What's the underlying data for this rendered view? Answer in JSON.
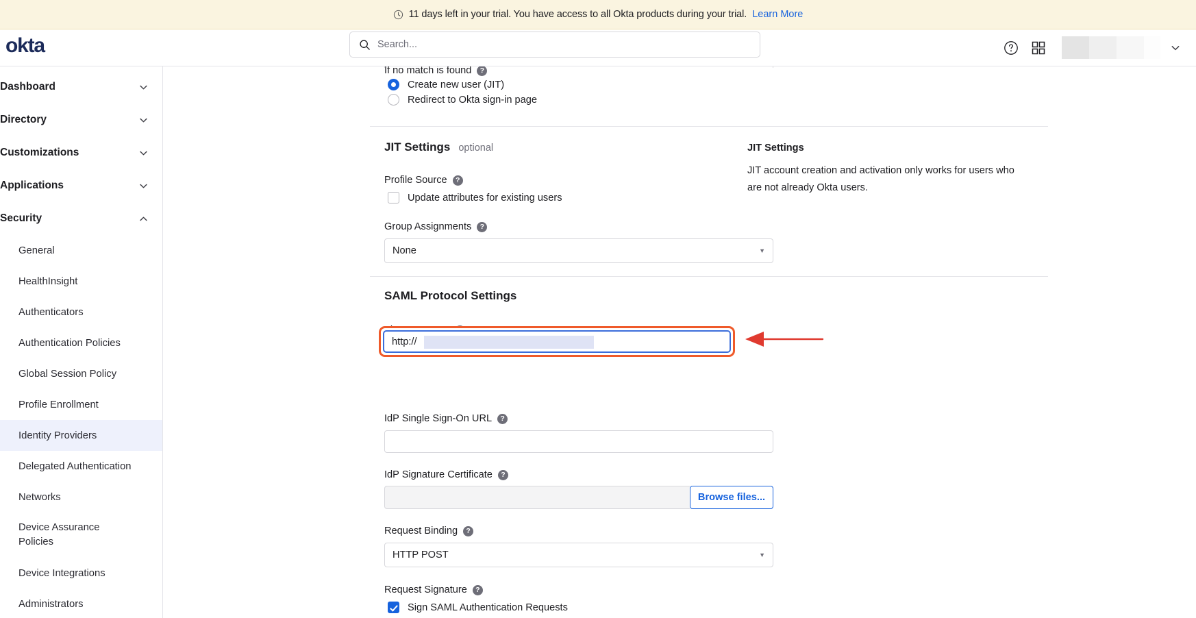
{
  "banner": {
    "icon": "clock-icon",
    "text": "11 days left in your trial. You have access to all Okta products during your trial.",
    "link_label": "Learn More",
    "link_color": "#1662dd",
    "background": "#faf4e0"
  },
  "header": {
    "logo_text": "okta",
    "logo_color": "#1c2b5a",
    "search": {
      "placeholder": "Search...",
      "value": "",
      "icon": "search-icon"
    },
    "help_icon": "question-circle-icon",
    "apps_icon": "grid-apps-icon",
    "user_caret_icon": "chevron-down-icon"
  },
  "sidebar": {
    "groups": [
      {
        "label": "Dashboard",
        "icon": "chevron-down-icon",
        "expanded": false
      },
      {
        "label": "Directory",
        "icon": "chevron-down-icon",
        "expanded": false
      },
      {
        "label": "Customizations",
        "icon": "chevron-down-icon",
        "expanded": false
      },
      {
        "label": "Applications",
        "icon": "chevron-down-icon",
        "expanded": false
      },
      {
        "label": "Security",
        "icon": "chevron-up-icon",
        "expanded": true
      }
    ],
    "security_items": [
      {
        "label": "General",
        "active": false
      },
      {
        "label": "HealthInsight",
        "active": false
      },
      {
        "label": "Authenticators",
        "active": false
      },
      {
        "label": "Authentication Policies",
        "active": false
      },
      {
        "label": "Global Session Policy",
        "active": false
      },
      {
        "label": "Profile Enrollment",
        "active": false
      },
      {
        "label": "Identity Providers",
        "active": true
      },
      {
        "label": "Delegated Authentication",
        "active": false
      },
      {
        "label": "Networks",
        "active": false
      },
      {
        "label": "Device Assurance Policies",
        "active": false
      },
      {
        "label": "Device Integrations",
        "active": false
      },
      {
        "label": "Administrators",
        "active": false
      }
    ],
    "active_background": "#eef1fc"
  },
  "main": {
    "no_match": {
      "label": "If no match is found",
      "help_icon": "help-circle-icon",
      "options": [
        {
          "label": "Create new user (JIT)",
          "selected": true
        },
        {
          "label": "Redirect to Okta sign-in page",
          "selected": false
        }
      ]
    },
    "jit_section": {
      "title": "JIT Settings",
      "optional_tag": "optional",
      "profile_source": {
        "label": "Profile Source",
        "help_icon": "help-circle-icon",
        "checkbox_label": "Update attributes for existing users",
        "checked": false
      },
      "group_assignments": {
        "label": "Group Assignments",
        "help_icon": "help-circle-icon",
        "value": "None",
        "caret_icon": "caret-down-icon"
      }
    },
    "saml_section": {
      "title": "SAML Protocol Settings",
      "idp_issuer_uri": {
        "label": "IdP Issuer URI",
        "help_icon": "help-circle-icon",
        "value": "http://",
        "focused": true,
        "focus_ring_color": "#ef5a2a",
        "focus_border_color": "#3b6ddb",
        "selection_color": "#dfe3f5"
      },
      "idp_sso_url": {
        "label": "IdP Single Sign-On URL",
        "help_icon": "help-circle-icon",
        "value": ""
      },
      "idp_signature_certificate": {
        "label": "IdP Signature Certificate",
        "help_icon": "help-circle-icon",
        "file_value": "",
        "browse_label": "Browse files..."
      },
      "request_binding": {
        "label": "Request Binding",
        "help_icon": "help-circle-icon",
        "value": "HTTP POST",
        "caret_icon": "caret-down-icon"
      },
      "request_signature": {
        "label": "Request Signature",
        "help_icon": "help-circle-icon",
        "checkbox_label": "Sign SAML Authentication Requests",
        "checked": true
      }
    },
    "help_panel": {
      "title": "JIT Settings",
      "body": "JIT account creation and activation only works for users who are not already Okta users."
    },
    "annotation": {
      "type": "arrow",
      "points_to": "idp-issuer-uri-input",
      "color": "#e03a2f"
    }
  }
}
